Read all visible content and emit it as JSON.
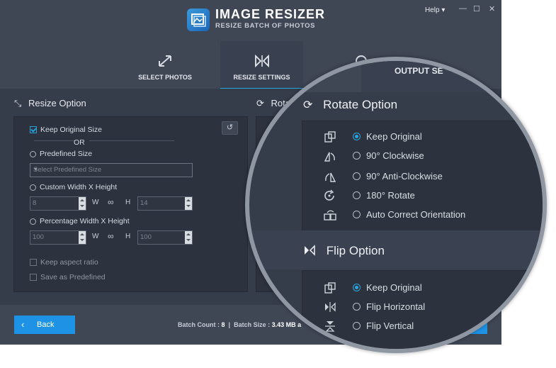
{
  "app": {
    "title": "IMAGE RESIZER",
    "subtitle": "RESIZE BATCH OF PHOTOS"
  },
  "window_controls": {
    "help": "Help",
    "help_arrow": "▾",
    "minimize": "—",
    "maximize": "☐",
    "close": "✕"
  },
  "tabs": [
    {
      "label": "SELECT PHOTOS",
      "icon": "expand-arrows-icon",
      "active": false
    },
    {
      "label": "RESIZE SETTINGS",
      "icon": "resize-settings-icon",
      "active": true
    },
    {
      "label": "OUTPUT SE",
      "icon": "output-icon",
      "active": false
    }
  ],
  "resize": {
    "heading": "Resize Option",
    "keep_original": "Keep Original Size",
    "or": "OR",
    "predefined": "Predefined Size",
    "predefined_placeholder": "Select Predefined Size",
    "custom": "Custom Width X Height",
    "custom_w": "8",
    "custom_h": "14",
    "w": "W",
    "h": "H",
    "link": "∞",
    "percentage": "Percentage Width X Height",
    "pct_w": "100",
    "pct_h": "100",
    "keep_aspect": "Keep aspect ratio",
    "save_predefined": "Save as Predefined",
    "reset_icon": "↺"
  },
  "rotate_partial": {
    "heading": "Rota"
  },
  "footer": {
    "back": "Back",
    "back_icon": "‹",
    "batch_count_label": "Batch Count :",
    "batch_count": "8",
    "sep": "|",
    "batch_size_label": "Batch Size :",
    "batch_size": "3.43 MB a"
  },
  "magnifier": {
    "tab_label": "OUTPUT SE",
    "rotate_heading": "Rotate Option",
    "rotate_options": [
      {
        "label": "Keep Original",
        "selected": true,
        "icon": "keep-original-icon"
      },
      {
        "label": "90° Clockwise",
        "selected": false,
        "icon": "rotate-clockwise-icon"
      },
      {
        "label": "90° Anti-Clockwise",
        "selected": false,
        "icon": "rotate-anticlockwise-icon"
      },
      {
        "label": "180° Rotate",
        "selected": false,
        "icon": "rotate-180-icon"
      },
      {
        "label": "Auto Correct Orientation",
        "selected": false,
        "icon": "auto-orient-icon"
      }
    ],
    "flip_heading": "Flip Option",
    "flip_options": [
      {
        "label": "Keep Original",
        "selected": true,
        "icon": "keep-original-icon"
      },
      {
        "label": "Flip Horizontal",
        "selected": false,
        "icon": "flip-horizontal-icon"
      },
      {
        "label": "Flip Vertical",
        "selected": false,
        "icon": "flip-vertical-icon"
      }
    ]
  },
  "colors": {
    "accent": "#1e93e6",
    "window_bg": "#3f4654",
    "panel_bg": "#2d333e",
    "tab_underline": "#27a7e1"
  }
}
